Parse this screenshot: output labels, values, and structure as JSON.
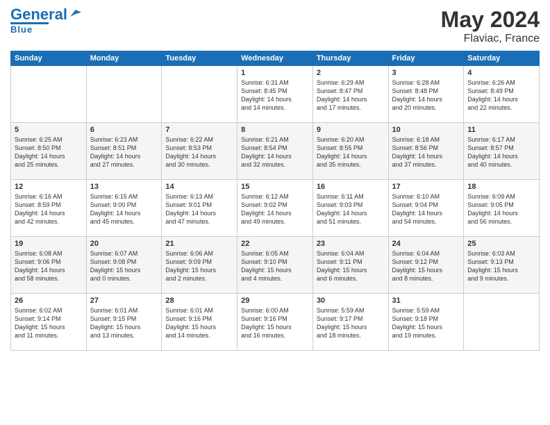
{
  "header": {
    "logo_general": "General",
    "logo_blue": "Blue",
    "month_year": "May 2024",
    "location": "Flaviac, France"
  },
  "days_of_week": [
    "Sunday",
    "Monday",
    "Tuesday",
    "Wednesday",
    "Thursday",
    "Friday",
    "Saturday"
  ],
  "weeks": [
    [
      {
        "day": "",
        "info": ""
      },
      {
        "day": "",
        "info": ""
      },
      {
        "day": "",
        "info": ""
      },
      {
        "day": "1",
        "info": "Sunrise: 6:31 AM\nSunset: 8:45 PM\nDaylight: 14 hours\nand 14 minutes."
      },
      {
        "day": "2",
        "info": "Sunrise: 6:29 AM\nSunset: 8:47 PM\nDaylight: 14 hours\nand 17 minutes."
      },
      {
        "day": "3",
        "info": "Sunrise: 6:28 AM\nSunset: 8:48 PM\nDaylight: 14 hours\nand 20 minutes."
      },
      {
        "day": "4",
        "info": "Sunrise: 6:26 AM\nSunset: 8:49 PM\nDaylight: 14 hours\nand 22 minutes."
      }
    ],
    [
      {
        "day": "5",
        "info": "Sunrise: 6:25 AM\nSunset: 8:50 PM\nDaylight: 14 hours\nand 25 minutes."
      },
      {
        "day": "6",
        "info": "Sunrise: 6:23 AM\nSunset: 8:51 PM\nDaylight: 14 hours\nand 27 minutes."
      },
      {
        "day": "7",
        "info": "Sunrise: 6:22 AM\nSunset: 8:53 PM\nDaylight: 14 hours\nand 30 minutes."
      },
      {
        "day": "8",
        "info": "Sunrise: 6:21 AM\nSunset: 8:54 PM\nDaylight: 14 hours\nand 32 minutes."
      },
      {
        "day": "9",
        "info": "Sunrise: 6:20 AM\nSunset: 8:55 PM\nDaylight: 14 hours\nand 35 minutes."
      },
      {
        "day": "10",
        "info": "Sunrise: 6:18 AM\nSunset: 8:56 PM\nDaylight: 14 hours\nand 37 minutes."
      },
      {
        "day": "11",
        "info": "Sunrise: 6:17 AM\nSunset: 8:57 PM\nDaylight: 14 hours\nand 40 minutes."
      }
    ],
    [
      {
        "day": "12",
        "info": "Sunrise: 6:16 AM\nSunset: 8:59 PM\nDaylight: 14 hours\nand 42 minutes."
      },
      {
        "day": "13",
        "info": "Sunrise: 6:15 AM\nSunset: 9:00 PM\nDaylight: 14 hours\nand 45 minutes."
      },
      {
        "day": "14",
        "info": "Sunrise: 6:13 AM\nSunset: 9:01 PM\nDaylight: 14 hours\nand 47 minutes."
      },
      {
        "day": "15",
        "info": "Sunrise: 6:12 AM\nSunset: 9:02 PM\nDaylight: 14 hours\nand 49 minutes."
      },
      {
        "day": "16",
        "info": "Sunrise: 6:11 AM\nSunset: 9:03 PM\nDaylight: 14 hours\nand 51 minutes."
      },
      {
        "day": "17",
        "info": "Sunrise: 6:10 AM\nSunset: 9:04 PM\nDaylight: 14 hours\nand 54 minutes."
      },
      {
        "day": "18",
        "info": "Sunrise: 6:09 AM\nSunset: 9:05 PM\nDaylight: 14 hours\nand 56 minutes."
      }
    ],
    [
      {
        "day": "19",
        "info": "Sunrise: 6:08 AM\nSunset: 9:06 PM\nDaylight: 14 hours\nand 58 minutes."
      },
      {
        "day": "20",
        "info": "Sunrise: 6:07 AM\nSunset: 9:08 PM\nDaylight: 15 hours\nand 0 minutes."
      },
      {
        "day": "21",
        "info": "Sunrise: 6:06 AM\nSunset: 9:09 PM\nDaylight: 15 hours\nand 2 minutes."
      },
      {
        "day": "22",
        "info": "Sunrise: 6:05 AM\nSunset: 9:10 PM\nDaylight: 15 hours\nand 4 minutes."
      },
      {
        "day": "23",
        "info": "Sunrise: 6:04 AM\nSunset: 9:11 PM\nDaylight: 15 hours\nand 6 minutes."
      },
      {
        "day": "24",
        "info": "Sunrise: 6:04 AM\nSunset: 9:12 PM\nDaylight: 15 hours\nand 8 minutes."
      },
      {
        "day": "25",
        "info": "Sunrise: 6:03 AM\nSunset: 9:13 PM\nDaylight: 15 hours\nand 9 minutes."
      }
    ],
    [
      {
        "day": "26",
        "info": "Sunrise: 6:02 AM\nSunset: 9:14 PM\nDaylight: 15 hours\nand 11 minutes."
      },
      {
        "day": "27",
        "info": "Sunrise: 6:01 AM\nSunset: 9:15 PM\nDaylight: 15 hours\nand 13 minutes."
      },
      {
        "day": "28",
        "info": "Sunrise: 6:01 AM\nSunset: 9:16 PM\nDaylight: 15 hours\nand 14 minutes."
      },
      {
        "day": "29",
        "info": "Sunrise: 6:00 AM\nSunset: 9:16 PM\nDaylight: 15 hours\nand 16 minutes."
      },
      {
        "day": "30",
        "info": "Sunrise: 5:59 AM\nSunset: 9:17 PM\nDaylight: 15 hours\nand 18 minutes."
      },
      {
        "day": "31",
        "info": "Sunrise: 5:59 AM\nSunset: 9:18 PM\nDaylight: 15 hours\nand 19 minutes."
      },
      {
        "day": "",
        "info": ""
      }
    ]
  ]
}
